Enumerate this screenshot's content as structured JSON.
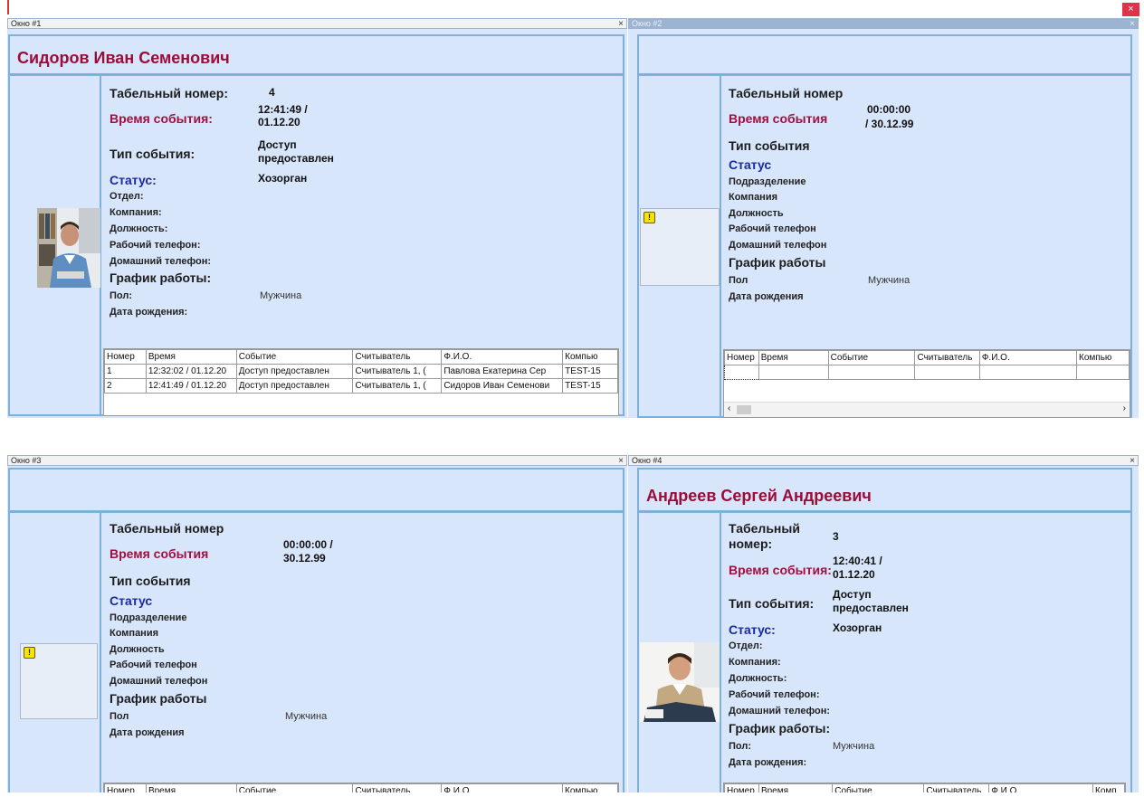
{
  "top": {
    "close_glyph": "×"
  },
  "w1": {
    "title": "Окно #1",
    "name": "Сидоров Иван Семенович",
    "labels": {
      "tab": "Табельный номер:",
      "time": "Время события:",
      "type": "Тип события:",
      "status": "Статус:",
      "dept": "Отдел:",
      "company": "Компания:",
      "position": "Должность:",
      "work_phone": "Рабочий телефон:",
      "home_phone": "Домашний телефон:",
      "schedule": "График работы:",
      "sex": "Пол:",
      "birth": "Дата рождения:"
    },
    "values": {
      "tab": "4",
      "time1": "12:41:49 /",
      "time2": "01.12.20",
      "type1": "Доступ",
      "type2": "предоставлен",
      "status": "Хозорган",
      "sex": "Мужчина"
    },
    "grid": {
      "columns": [
        "Номер",
        "Время",
        "Событие",
        "Считыватель",
        "Ф.И.О.",
        "Компью"
      ],
      "rows": [
        [
          "1",
          "12:32:02 / 01.12.20",
          "Доступ предоставлен",
          "Считыватель 1, (",
          "Павлова Екатерина Сер",
          "TEST-15"
        ],
        [
          "2",
          "12:41:49 / 01.12.20",
          "Доступ предоставлен",
          "Считыватель 1, (",
          "Сидоров Иван Семенови",
          "TEST-15"
        ]
      ]
    }
  },
  "w2": {
    "title": "Окно #2",
    "labels": {
      "tab": "Табельный номер",
      "time": "Время события",
      "type": "Тип события",
      "status": "Статус",
      "dept": "Подразделение",
      "company": "Компания",
      "position": "Должность",
      "work_phone": "Рабочий телефон",
      "home_phone": "Домашний телефон",
      "schedule": "График работы",
      "sex": "Пол",
      "birth": "Дата рождения"
    },
    "values": {
      "time1": "00:00:00",
      "time2": "/ 30.12.99",
      "sex": "Мужчина"
    },
    "grid": {
      "columns": [
        "Номер",
        "Время",
        "Событие",
        "Считыватель",
        "Ф.И.О.",
        "Компью"
      ]
    }
  },
  "w3": {
    "title": "Окно #3",
    "labels": {
      "tab": "Табельный номер",
      "time": "Время события",
      "type": "Тип события",
      "status": "Статус",
      "dept": "Подразделение",
      "company": "Компания",
      "position": "Должность",
      "work_phone": "Рабочий телефон",
      "home_phone": "Домашний телефон",
      "schedule": "График работы",
      "sex": "Пол",
      "birth": "Дата рождения"
    },
    "values": {
      "time1": "00:00:00 /",
      "time2": "30.12.99",
      "sex": "Мужчина"
    },
    "grid": {
      "columns": [
        "Номер",
        "Время",
        "Событие",
        "Считыватель",
        "Ф.И.О.",
        "Компью"
      ]
    }
  },
  "w4": {
    "title": "Окно #4",
    "name": "Андреев  Сергей Андреевич",
    "labels": {
      "tab1": "Табельный",
      "tab2": "номер:",
      "time": "Время события:",
      "type": "Тип события:",
      "status": "Статус:",
      "dept": "Отдел:",
      "company": "Компания:",
      "position": "Должность:",
      "work_phone": "Рабочий телефон:",
      "home_phone": "Домашний телефон:",
      "schedule": "График работы:",
      "sex": "Пол:",
      "birth": "Дата рождения:"
    },
    "values": {
      "tab": "3",
      "time1": "12:40:41 /",
      "time2": "01.12.20",
      "type1": "Доступ",
      "type2": "предоставлен",
      "status": "Хозорган",
      "sex": "Мужчина"
    },
    "grid": {
      "columns": [
        "Номер",
        "Время",
        "Событие",
        "Считыватель",
        "Ф.И.О.",
        "Комп"
      ]
    }
  }
}
